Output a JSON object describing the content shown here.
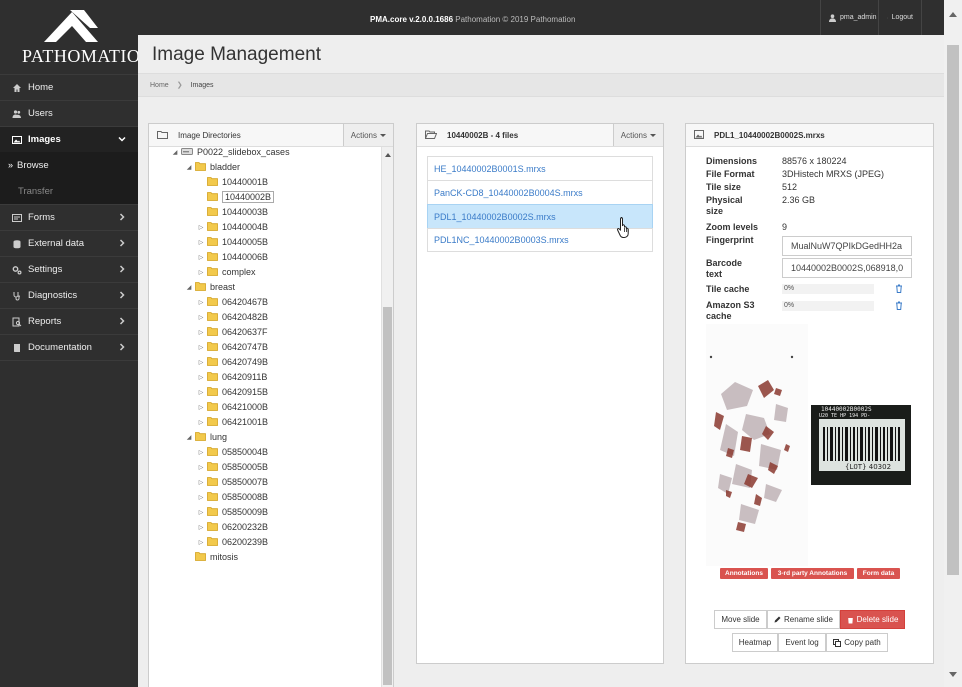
{
  "topbar": {
    "product": "PMA.core v.2.0.0.1686",
    "copyright": "Pathomation © 2019 Pathomation",
    "user": "pma_admin",
    "logout": "Logout"
  },
  "logo": {
    "text": "PATHOMATION"
  },
  "nav": {
    "home": "Home",
    "users": "Users",
    "images": "Images",
    "browse": "Browse",
    "transfer": "Transfer",
    "forms": "Forms",
    "external_data": "External data",
    "settings": "Settings",
    "diagnostics": "Diagnostics",
    "reports": "Reports",
    "documentation": "Documentation"
  },
  "page": {
    "title": "Image Management",
    "breadcrumb": [
      "Home",
      "Images"
    ]
  },
  "directories": {
    "header": "Image Directories",
    "actions": "Actions",
    "tree": [
      {
        "label": "P0022_slidebox_cases",
        "level": 0,
        "toggle": "open",
        "icon": "drive"
      },
      {
        "label": "bladder",
        "level": 1,
        "toggle": "open",
        "icon": "folder"
      },
      {
        "label": "10440001B",
        "level": 2,
        "toggle": "none",
        "icon": "folder"
      },
      {
        "label": "10440002B",
        "level": 2,
        "toggle": "none",
        "icon": "folder",
        "selected": true
      },
      {
        "label": "10440003B",
        "level": 2,
        "toggle": "none",
        "icon": "folder"
      },
      {
        "label": "10440004B",
        "level": 2,
        "toggle": "closed",
        "icon": "folder"
      },
      {
        "label": "10440005B",
        "level": 2,
        "toggle": "closed",
        "icon": "folder"
      },
      {
        "label": "10440006B",
        "level": 2,
        "toggle": "closed",
        "icon": "folder"
      },
      {
        "label": "complex",
        "level": 2,
        "toggle": "closed",
        "icon": "folder"
      },
      {
        "label": "breast",
        "level": 1,
        "toggle": "open",
        "icon": "folder"
      },
      {
        "label": "06420467B",
        "level": 2,
        "toggle": "closed",
        "icon": "folder"
      },
      {
        "label": "06420482B",
        "level": 2,
        "toggle": "closed",
        "icon": "folder"
      },
      {
        "label": "06420637F",
        "level": 2,
        "toggle": "closed",
        "icon": "folder"
      },
      {
        "label": "06420747B",
        "level": 2,
        "toggle": "closed",
        "icon": "folder"
      },
      {
        "label": "06420749B",
        "level": 2,
        "toggle": "closed",
        "icon": "folder"
      },
      {
        "label": "06420911B",
        "level": 2,
        "toggle": "closed",
        "icon": "folder"
      },
      {
        "label": "06420915B",
        "level": 2,
        "toggle": "closed",
        "icon": "folder"
      },
      {
        "label": "06421000B",
        "level": 2,
        "toggle": "closed",
        "icon": "folder"
      },
      {
        "label": "06421001B",
        "level": 2,
        "toggle": "closed",
        "icon": "folder"
      },
      {
        "label": "lung",
        "level": 1,
        "toggle": "open",
        "icon": "folder"
      },
      {
        "label": "05850004B",
        "level": 2,
        "toggle": "closed",
        "icon": "folder"
      },
      {
        "label": "05850005B",
        "level": 2,
        "toggle": "closed",
        "icon": "folder"
      },
      {
        "label": "05850007B",
        "level": 2,
        "toggle": "closed",
        "icon": "folder"
      },
      {
        "label": "05850008B",
        "level": 2,
        "toggle": "closed",
        "icon": "folder"
      },
      {
        "label": "05850009B",
        "level": 2,
        "toggle": "closed",
        "icon": "folder"
      },
      {
        "label": "06200232B",
        "level": 2,
        "toggle": "closed",
        "icon": "folder"
      },
      {
        "label": "06200239B",
        "level": 2,
        "toggle": "closed",
        "icon": "folder"
      },
      {
        "label": "mitosis",
        "level": 1,
        "toggle": "none",
        "icon": "folder"
      }
    ]
  },
  "files": {
    "header": "10440002B - 4 files",
    "actions": "Actions",
    "items": [
      {
        "name": "HE_10440002B0001S.mrxs",
        "selected": false
      },
      {
        "name": "PanCK-CD8_10440002B0004S.mrxs",
        "selected": false
      },
      {
        "name": "PDL1_10440002B0002S.mrxs",
        "selected": true
      },
      {
        "name": "PDL1NC_10440002B0003S.mrxs",
        "selected": false
      }
    ]
  },
  "details": {
    "header": "PDL1_10440002B0002S.mrxs",
    "dimensions_label": "Dimensions",
    "dimensions": "88576 x 180224",
    "format_label": "File Format",
    "format": "3DHistech MRXS (JPEG)",
    "tilesize_label": "Tile size",
    "tilesize": "512",
    "physical_label": "Physical size",
    "physical": "2.36 GB",
    "zoom_label": "Zoom levels",
    "zoom": "9",
    "fingerprint_label": "Fingerprint",
    "fingerprint": "MualNuW7QPIkDGedHH2a",
    "barcode_label": "Barcode text",
    "barcode": "10440002B0002S,068918,0",
    "tilecache_label": "Tile cache",
    "tilecache": "0%",
    "s3_label": "Amazon S3 cache",
    "s3": "0%",
    "label_image_text": [
      "10440002B0002S",
      "U20 TE HP 194 PD-",
      "{L0T} 40302"
    ],
    "tags": [
      "Annotations",
      "3-rd party Annotations",
      "Form data"
    ],
    "buttons": {
      "move": "Move slide",
      "rename": "Rename slide",
      "delete": "Delete slide",
      "heatmap": "Heatmap",
      "eventlog": "Event log",
      "copypath": "Copy path"
    }
  },
  "colors": {
    "accent_danger": "#d9534f",
    "selected_row": "#c8e6fb",
    "link": "#3a7bc8",
    "sidebar": "#2f2f2f"
  }
}
